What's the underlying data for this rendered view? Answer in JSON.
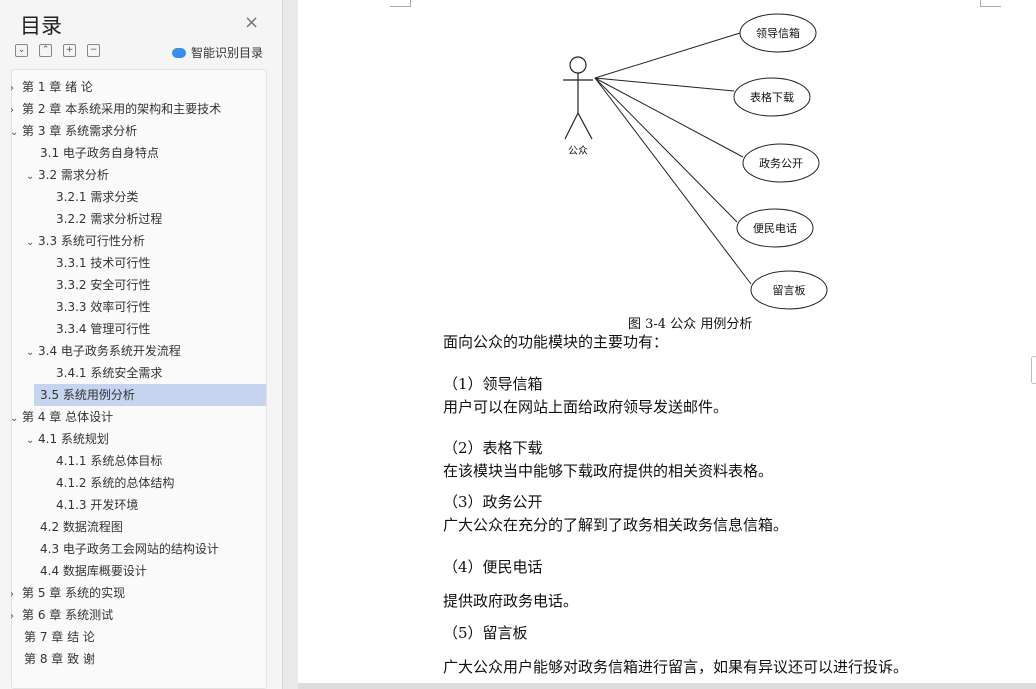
{
  "toc_panel": {
    "title": "目录",
    "close_glyph": "×",
    "tools": [
      "expand-all-icon",
      "collapse-all-icon",
      "add-icon",
      "remove-icon"
    ],
    "smart_label": "智能识别目录",
    "selected_color": "#c6d4ef"
  },
  "toc": [
    {
      "text": "第 1 章  绪  论",
      "level": 0,
      "arrow": "›",
      "selected": false
    },
    {
      "text": "第 2 章  本系统采用的架构和主要技术",
      "level": 0,
      "arrow": "›",
      "selected": false
    },
    {
      "text": "第 3 章  系统需求分析",
      "level": 0,
      "arrow": "⌄",
      "selected": false
    },
    {
      "text": "3.1  电子政务自身特点",
      "level": 1,
      "arrow": "",
      "selected": false
    },
    {
      "text": "3.2  需求分析",
      "level": 1,
      "arrow": "⌄",
      "selected": false
    },
    {
      "text": "3.2.1  需求分类",
      "level": 2,
      "arrow": "",
      "selected": false
    },
    {
      "text": "3.2.2  需求分析过程",
      "level": 2,
      "arrow": "",
      "selected": false
    },
    {
      "text": "3.3  系统可行性分析",
      "level": 1,
      "arrow": "⌄",
      "selected": false
    },
    {
      "text": "3.3.1  技术可行性",
      "level": 2,
      "arrow": "",
      "selected": false
    },
    {
      "text": "3.3.2  安全可行性",
      "level": 2,
      "arrow": "",
      "selected": false
    },
    {
      "text": "3.3.3  效率可行性",
      "level": 2,
      "arrow": "",
      "selected": false
    },
    {
      "text": "3.3.4  管理可行性",
      "level": 2,
      "arrow": "",
      "selected": false
    },
    {
      "text": "3.4  电子政务系统开发流程",
      "level": 1,
      "arrow": "⌄",
      "selected": false
    },
    {
      "text": "3.4.1  系统安全需求",
      "level": 2,
      "arrow": "",
      "selected": false
    },
    {
      "text": "3.5  系统用例分析",
      "level": 1,
      "arrow": "",
      "selected": true
    },
    {
      "text": "第 4 章  总体设计",
      "level": 0,
      "arrow": "⌄",
      "selected": false
    },
    {
      "text": "4.1  系统规划",
      "level": 1,
      "arrow": "⌄",
      "selected": false
    },
    {
      "text": "4.1.1  系统总体目标",
      "level": 2,
      "arrow": "",
      "selected": false
    },
    {
      "text": "4.1.2  系统的总体结构",
      "level": 2,
      "arrow": "",
      "selected": false
    },
    {
      "text": "4.1.3  开发环境",
      "level": 2,
      "arrow": "",
      "selected": false
    },
    {
      "text": "4.2  数据流程图",
      "level": 1,
      "arrow": "",
      "selected": false
    },
    {
      "text": "4.3  电子政务工会网站的结构设计",
      "level": 1,
      "arrow": "",
      "selected": false
    },
    {
      "text": "4.4  数据库概要设计",
      "level": 1,
      "arrow": "",
      "selected": false
    },
    {
      "text": "第 5 章    系统的实现",
      "level": 0,
      "arrow": "›",
      "selected": false
    },
    {
      "text": "第 6 章  系统测试",
      "level": 0,
      "arrow": "›",
      "selected": false
    },
    {
      "text": "第 7 章  结    论",
      "level": 0,
      "arrow": "",
      "selected": false
    },
    {
      "text": "第 8 章  致     谢",
      "level": 0,
      "arrow": "",
      "selected": false
    }
  ],
  "diagram": {
    "actor": "公众",
    "use_cases": [
      "领导信箱",
      "表格下载",
      "政务公开",
      "便民电话",
      "留言板"
    ]
  },
  "document": {
    "caption": "图  3-4 公众  用例分析",
    "paragraphs": [
      "面向公众的功能模块的主要功有：",
      "（1）领导信箱",
      "用户可以在网站上面给政府领导发送邮件。",
      "（2）表格下载",
      "在该模块当中能够下载政府提供的相关资料表格。",
      "（3）政务公开",
      "广大公众在充分的了解到了政务相关政务信息信箱。",
      "（4）便民电话",
      "提供政府政务电话。",
      "（5）留言板",
      "广大公众用户能够对政务信箱进行留言，如果有异议还可以进行投诉。"
    ]
  }
}
